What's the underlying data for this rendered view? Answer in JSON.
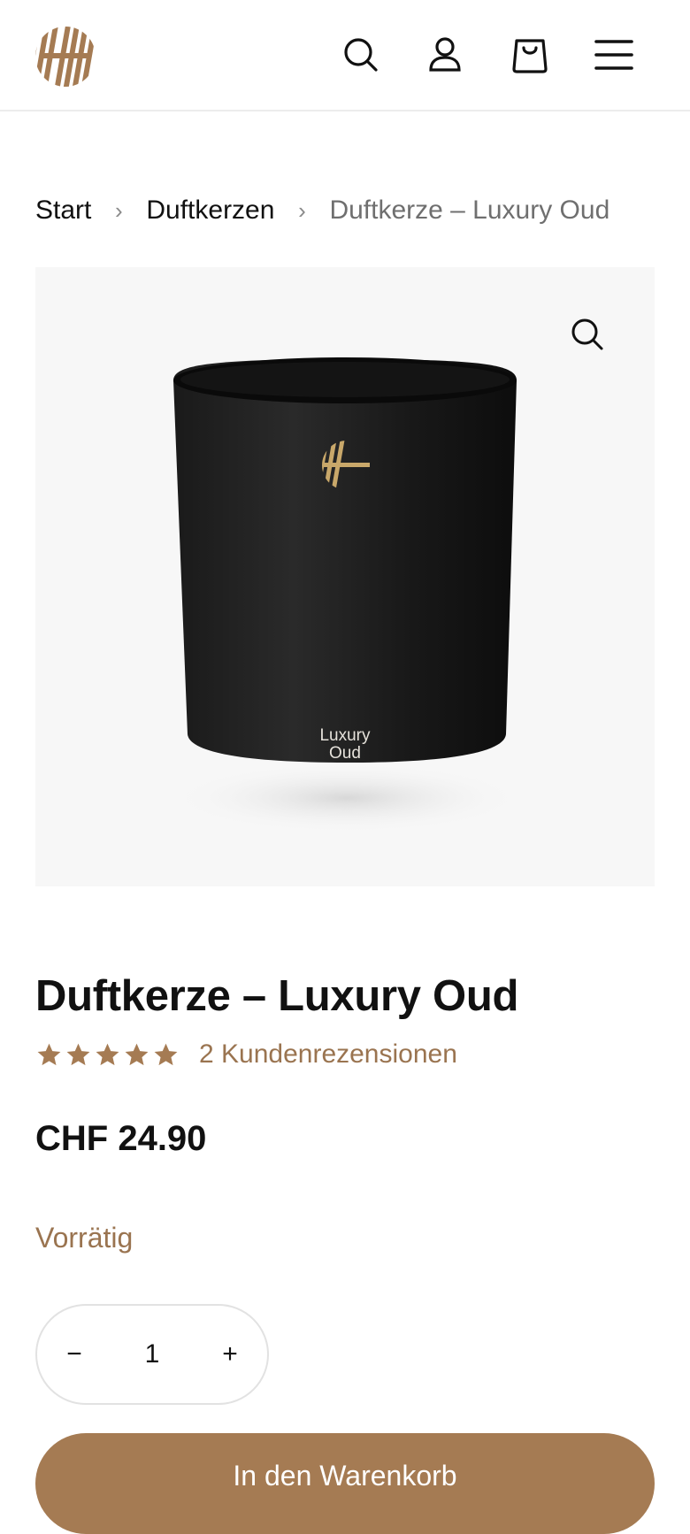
{
  "header": {
    "logo_icon": "brand-monogram-icon",
    "icons": [
      "search-icon",
      "user-icon",
      "bag-icon",
      "menu-icon"
    ]
  },
  "breadcrumb": {
    "items": [
      "Start",
      "Duftkerzen",
      "Duftkerze – Luxury Oud"
    ],
    "separator": "›"
  },
  "gallery": {
    "zoom_icon": "zoom-icon",
    "jar_label_line1": "Luxury",
    "jar_label_line2": "Oud"
  },
  "product": {
    "title": "Duftkerze – Luxury Oud",
    "rating": {
      "value": 5,
      "max": 5
    },
    "reviews_label": "2 Kundenrezensionen",
    "price": "CHF 24.90",
    "stock_status": "Vorrätig",
    "quantity": {
      "minus": "−",
      "value": "1",
      "plus": "+"
    },
    "add_to_cart_label": "In den Warenkorb"
  },
  "colors": {
    "brand_gold": "#a57b53",
    "text": "#111111",
    "muted": "#6f6f6f"
  }
}
